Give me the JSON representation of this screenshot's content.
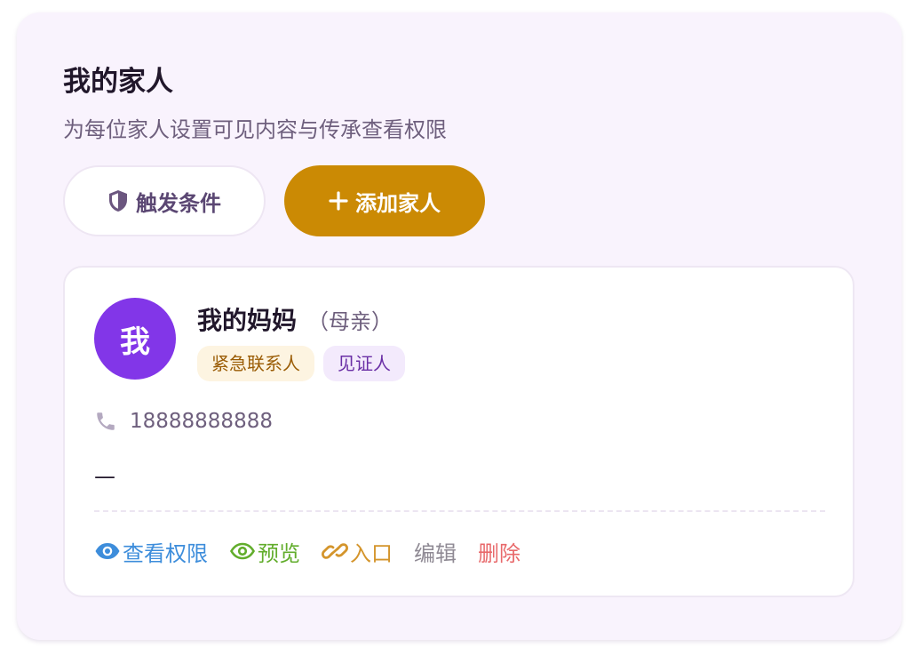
{
  "header": {
    "title": "我的家人",
    "subtitle": "为每位家人设置可见内容与传承查看权限"
  },
  "toolbar": {
    "trigger_label": "触发条件",
    "add_label": "添加家人",
    "accent_color": "#cb8a04"
  },
  "member": {
    "avatar_text": "我",
    "avatar_color": "#8236e8",
    "name": "我的妈妈",
    "relation": "（母亲）",
    "tags": [
      "紧急联系人",
      "见证人"
    ],
    "phone": "18888888888",
    "note": "—",
    "actions": {
      "view_permission": "查看权限",
      "preview": "预览",
      "entry": "入口",
      "edit": "编辑",
      "delete": "删除"
    }
  }
}
